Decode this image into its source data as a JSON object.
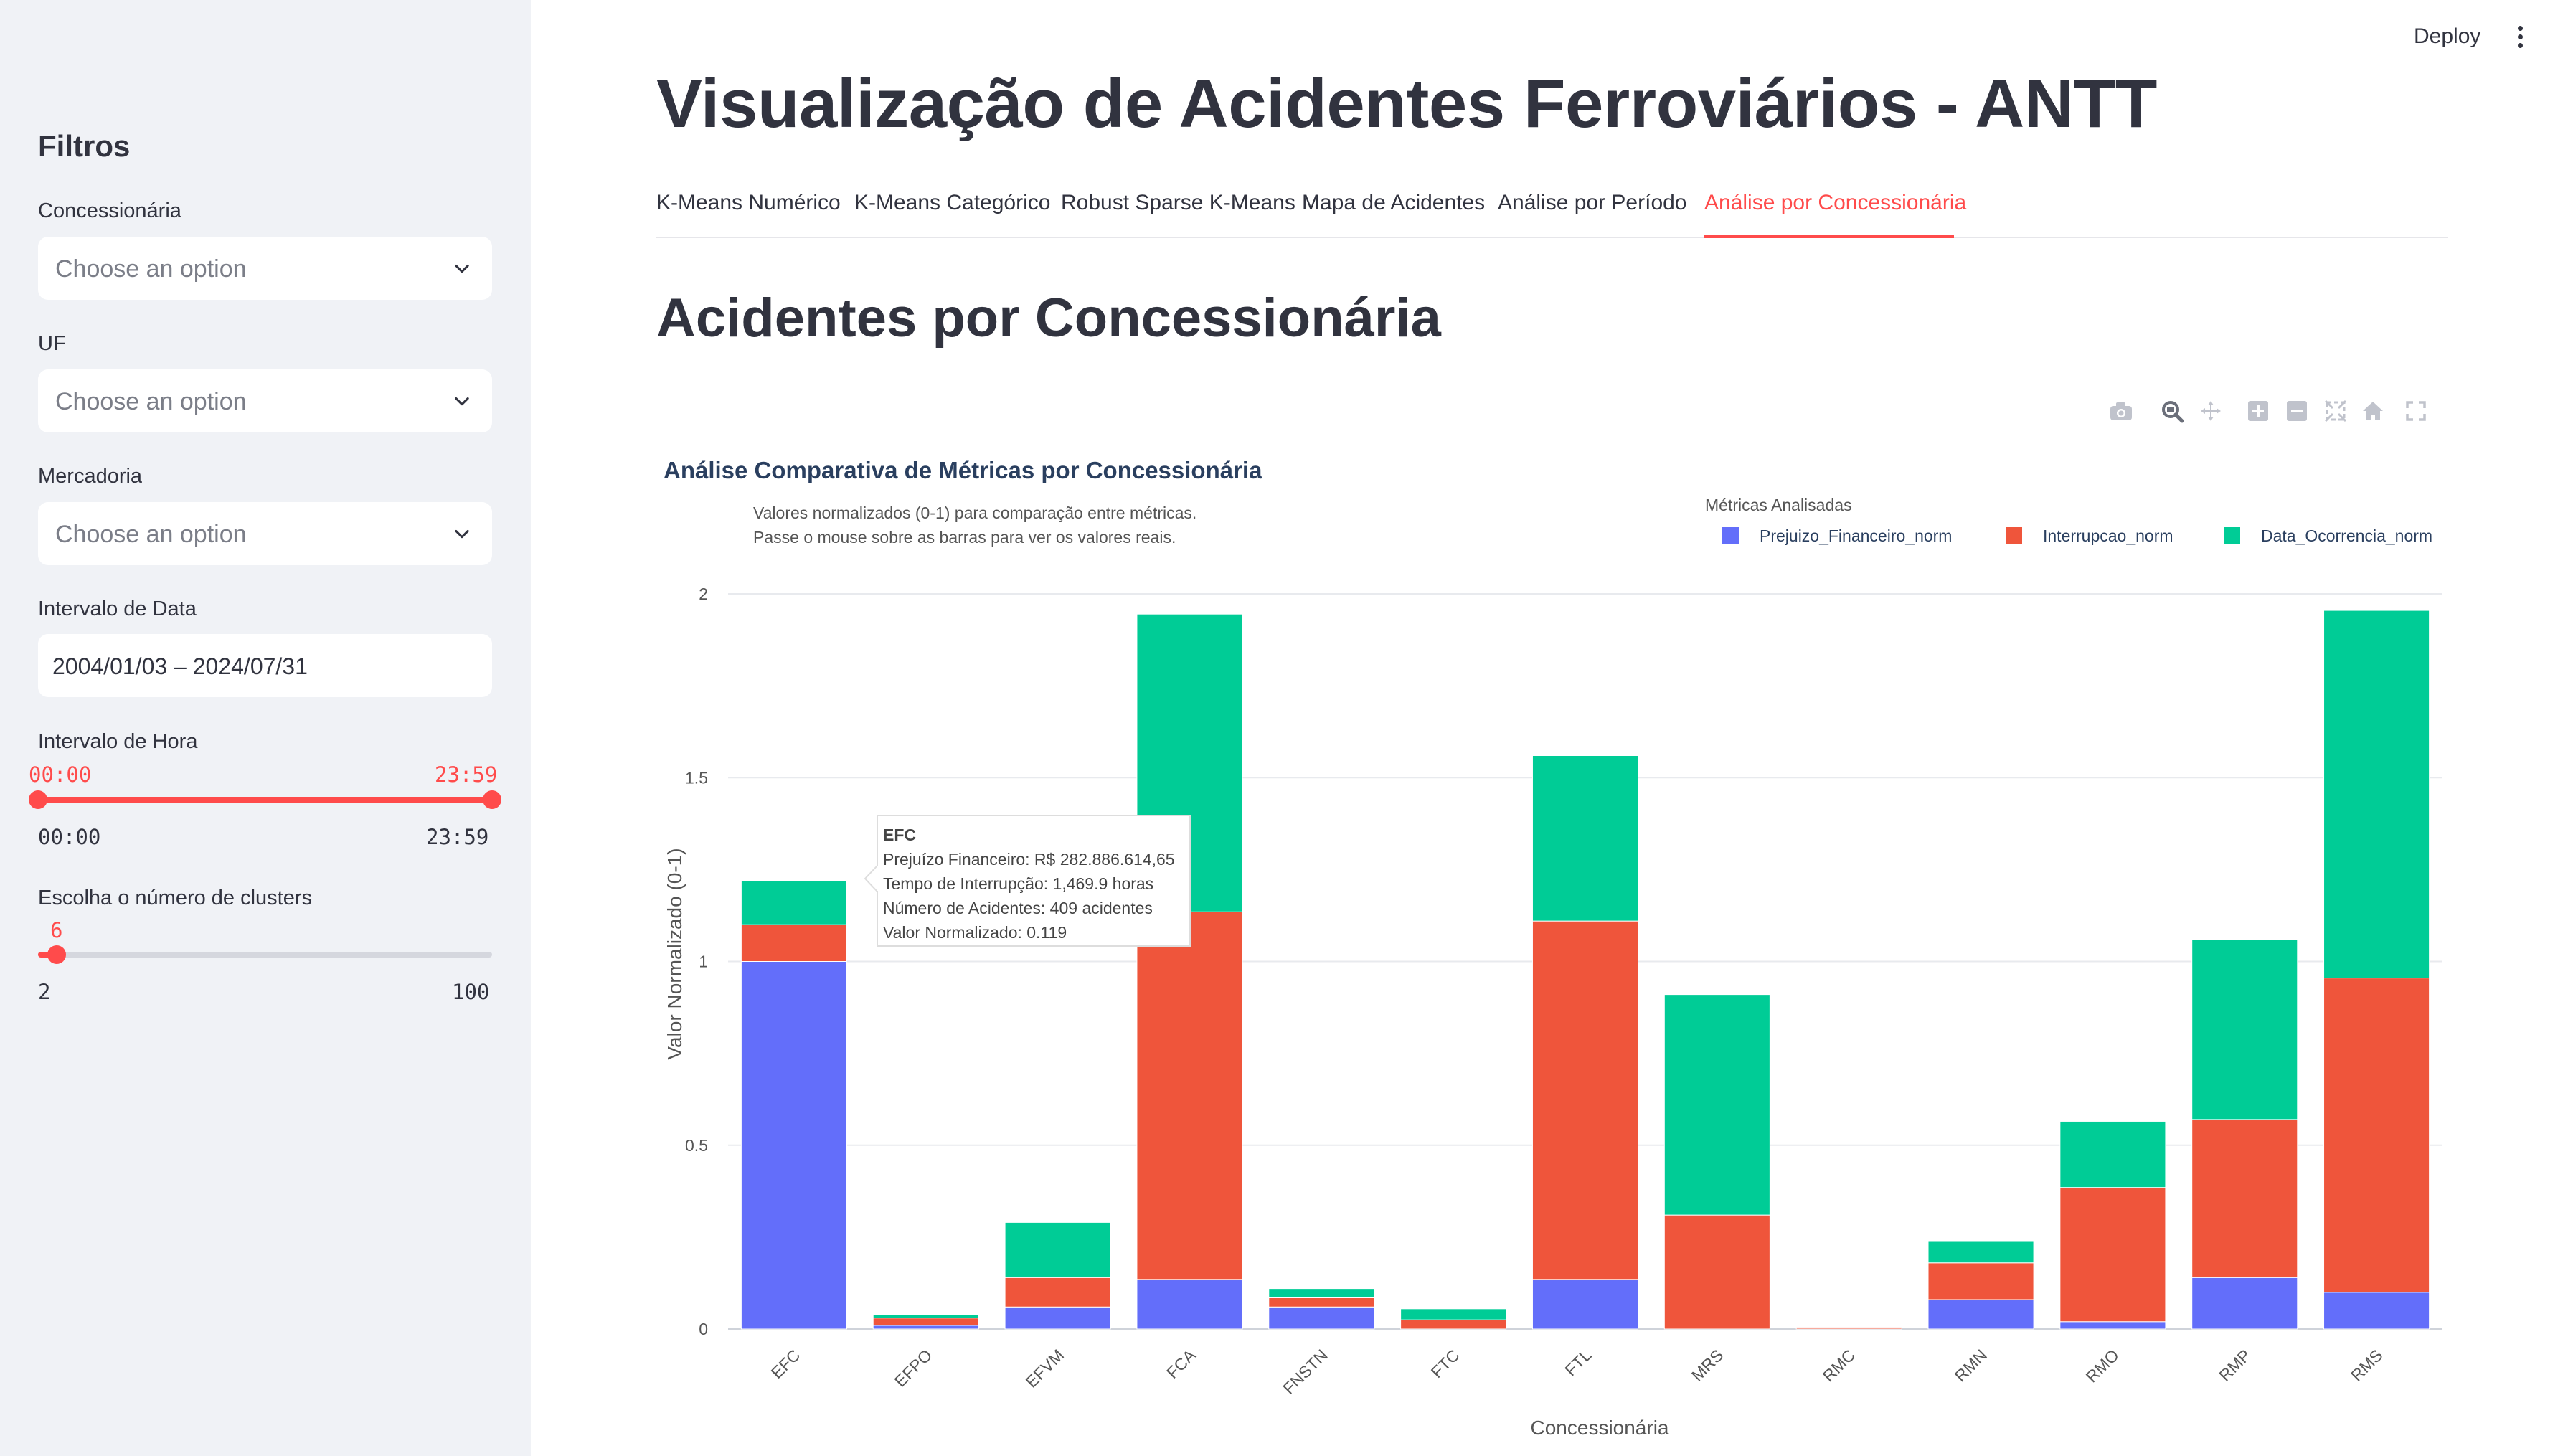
{
  "sidebar": {
    "title": "Filtros",
    "concessionaria_label": "Concessionária",
    "concessionaria_placeholder": "Choose an option",
    "uf_label": "UF",
    "uf_placeholder": "Choose an option",
    "mercadoria_label": "Mercadoria",
    "mercadoria_placeholder": "Choose an option",
    "data_label": "Intervalo de Data",
    "data_value": "2004/01/03 – 2024/07/31",
    "hora_label": "Intervalo de Hora",
    "hora_start": "00:00",
    "hora_end": "23:59",
    "hora_min": "00:00",
    "hora_max": "23:59",
    "clusters_label": "Escolha o número de clusters",
    "clusters_value": "6",
    "clusters_min": "2",
    "clusters_max": "100"
  },
  "header": {
    "deploy": "Deploy"
  },
  "main": {
    "title": "Visualização de Acidentes Ferroviários - ANTT",
    "tabs": [
      {
        "label": "K-Means Numérico"
      },
      {
        "label": "K-Means Categórico"
      },
      {
        "label": "Robust Sparse K-Means"
      },
      {
        "label": "Mapa de Acidentes"
      },
      {
        "label": "Análise por Período"
      },
      {
        "label": "Análise por Concessionária"
      }
    ],
    "active_tab": 5,
    "section_title": "Acidentes por Concessionária"
  },
  "colors": {
    "accent": "#ff4b4b",
    "prejuizo": "#636efa",
    "interrupcao": "#ef553b",
    "data_ocorrencia": "#00cc96"
  },
  "chart_data": {
    "type": "bar",
    "stacked": true,
    "title": "Análise Comparativa de Métricas por Concessionária",
    "subtitle": [
      "Valores normalizados (0-1) para comparação entre métricas.",
      "Passe o mouse sobre as barras para ver os valores reais."
    ],
    "xlabel": "Concessionária",
    "ylabel": "Valor Normalizado (0-1)",
    "ylim": [
      0,
      2
    ],
    "yticks": [
      "0",
      "0.5",
      "1",
      "1.5",
      "2"
    ],
    "legend_title": "Métricas Analisadas",
    "legend_position": "top-right",
    "grid": true,
    "categories": [
      "EFC",
      "EFPO",
      "EFVM",
      "FCA",
      "FNSTN",
      "FTC",
      "FTL",
      "MRS",
      "RMC",
      "RMN",
      "RMO",
      "RMP",
      "RMS"
    ],
    "series": [
      {
        "name": "Prejuizo_Financeiro_norm",
        "values": [
          1.0,
          0.01,
          0.06,
          0.135,
          0.06,
          0.0,
          0.135,
          0.0,
          0.0,
          0.08,
          0.02,
          0.14,
          0.1
        ]
      },
      {
        "name": "Interrupcao_norm",
        "values": [
          0.1,
          0.02,
          0.08,
          1.0,
          0.025,
          0.025,
          0.975,
          0.31,
          0.005,
          0.1,
          0.365,
          0.43,
          0.855
        ]
      },
      {
        "name": "Data_Ocorrencia_norm",
        "values": [
          0.119,
          0.01,
          0.15,
          0.81,
          0.025,
          0.03,
          0.45,
          0.6,
          0.0,
          0.06,
          0.18,
          0.49,
          1.0
        ]
      }
    ],
    "tooltip": {
      "title": "EFC",
      "lines": [
        "Prejuízo Financeiro: R$ 282.886.614,65",
        "Tempo de Interrupção: 1,469.9 horas",
        "Número de Acidentes: 409 acidentes",
        "Valor Normalizado: 0.119"
      ]
    }
  }
}
